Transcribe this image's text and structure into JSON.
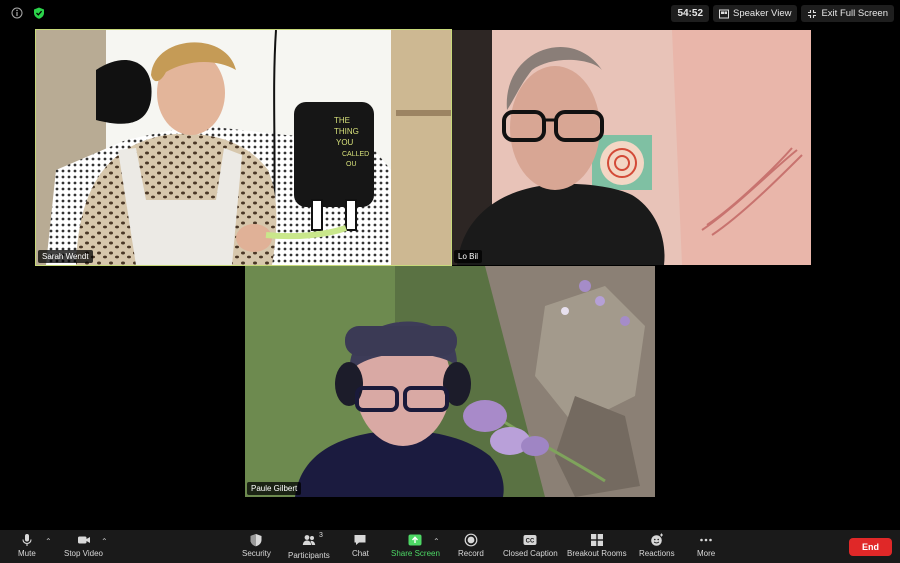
{
  "top": {
    "timer": "54:52",
    "speaker_view": "Speaker View",
    "exit_full_screen": "Exit Full Screen"
  },
  "participants": [
    {
      "name": "Sarah Wendt",
      "active": true
    },
    {
      "name": "Lo Bil",
      "active": false
    },
    {
      "name": "Paule Gilbert",
      "active": false
    }
  ],
  "sign_text": [
    "THE",
    "THING",
    "YOU",
    "CALLED",
    "OU"
  ],
  "toolbar": {
    "mute": "Mute",
    "stop_video": "Stop Video",
    "security": "Security",
    "participants": "Participants",
    "participants_count": "3",
    "chat": "Chat",
    "share_screen": "Share Screen",
    "record": "Record",
    "closed_caption": "Closed Caption",
    "breakout_rooms": "Breakout Rooms",
    "reactions": "Reactions",
    "more": "More",
    "end": "End"
  },
  "colors": {
    "active_speaker_border": "#c7d97a",
    "share_green": "#4dd865",
    "end_red": "#e02828",
    "security_green": "#2bd34a"
  }
}
